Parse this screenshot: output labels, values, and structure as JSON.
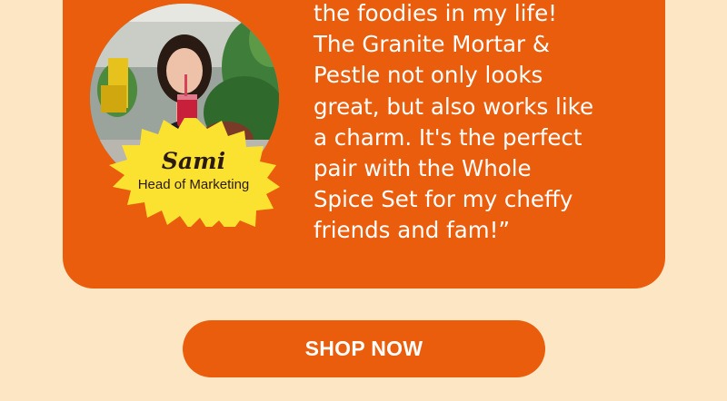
{
  "testimonial": {
    "quote_lines": [
      "the foodies in my life!",
      "The Granite Mortar &",
      "Pestle not only looks",
      "great, but also works like",
      "a charm. It's the perfect",
      "pair with the Whole",
      "Spice Set for my cheffy",
      "friends and fam!”"
    ],
    "author_name": "Sami",
    "author_role": "Head of Marketing"
  },
  "cta": {
    "label": "SHOP NOW"
  },
  "colors": {
    "background": "#fde6c3",
    "card": "#ea5d0c",
    "badge": "#fbe230",
    "text_light": "#ffffff",
    "text_dark": "#2b1a12"
  }
}
